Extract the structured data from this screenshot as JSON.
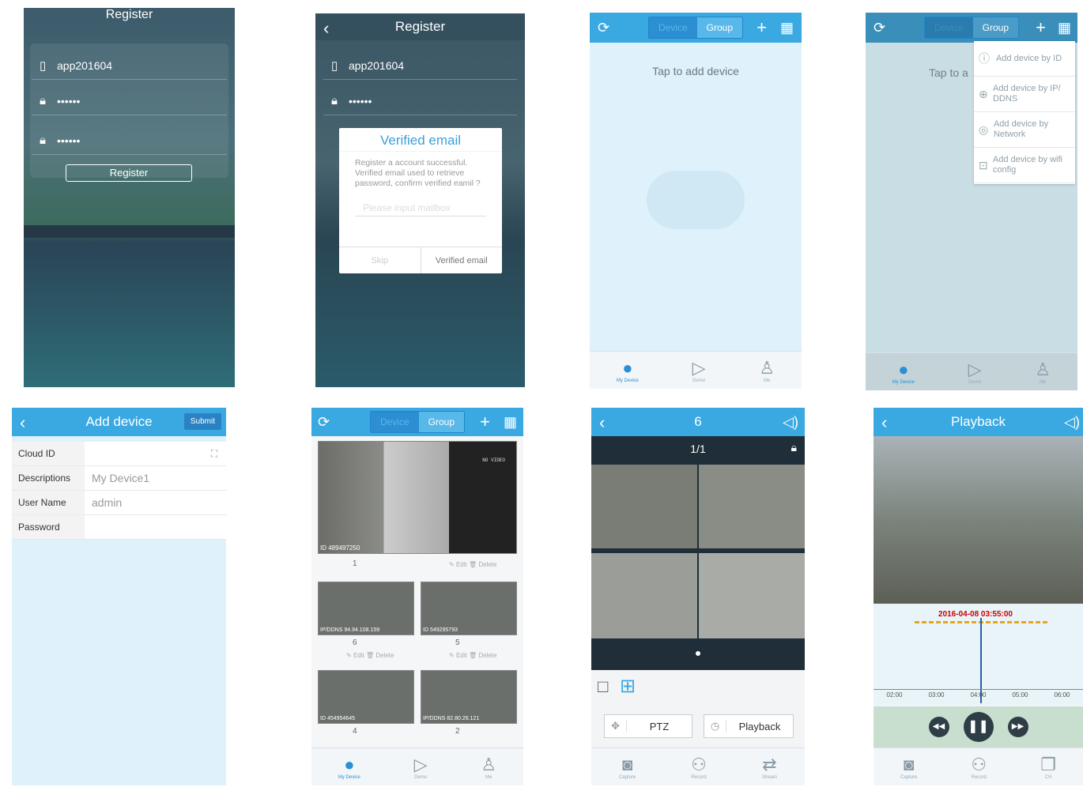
{
  "register1": {
    "title": "Register",
    "user": "app201604",
    "pwd": "••••••",
    "pwd2": "••••••",
    "button": "Register"
  },
  "register2": {
    "title": "Register",
    "user": "app201604",
    "pwd": "••••••",
    "dialog_title": "Verified email",
    "dialog_body": "Register a account successful. Verified email used to retrieve password, confirm verified eamil ?",
    "dialog_placeholder": "Please input mailbox",
    "skip": "Skip",
    "verify": "Verified email"
  },
  "devicelist": {
    "tab_device": "Device",
    "tab_group": "Group",
    "hint": "Tap to add device"
  },
  "addmenu": {
    "tab_device": "Device",
    "tab_group": "Group",
    "hint": "Tap to a",
    "items": [
      "Add device by ID",
      "Add device by IP/ DDNS",
      "Add device by Network",
      "Add device by wifi config"
    ]
  },
  "tabs": {
    "my_device": "My Device",
    "demo": "Demo",
    "me": "Me"
  },
  "adddevice": {
    "title": "Add device",
    "submit": "Submit",
    "rows": [
      {
        "label": "Cloud ID",
        "value": ""
      },
      {
        "label": "Descriptions",
        "value": "My Device1"
      },
      {
        "label": "User Name",
        "value": "admin"
      },
      {
        "label": "Password",
        "value": ""
      }
    ]
  },
  "grid": {
    "tab_device": "Device",
    "tab_group": "Group",
    "no_video": "NO VIDEO",
    "devices": [
      {
        "id": "ID 489497250",
        "name": "1"
      },
      {
        "id": "IP/DDNS 94.94.108.159",
        "name": "6"
      },
      {
        "id": "ID 549295793",
        "name": "5"
      },
      {
        "id": "ID 454954645",
        "name": "4"
      },
      {
        "id": "IP/DDNS 82.80.26.121",
        "name": "2"
      }
    ],
    "edit": "Edit",
    "delete": "Delete"
  },
  "live": {
    "title": "6",
    "pager": "1/1",
    "ptz": "PTZ",
    "playback": "Playback",
    "bottom": [
      "Capture",
      "Record",
      "Stream"
    ]
  },
  "playback": {
    "title": "Playback",
    "time": "2016-04-08 03:55:00",
    "ticks": [
      "02:00",
      "03:00",
      "04:00",
      "05:00",
      "06:00"
    ],
    "bottom": [
      "Capture",
      "Record",
      "CH"
    ]
  }
}
